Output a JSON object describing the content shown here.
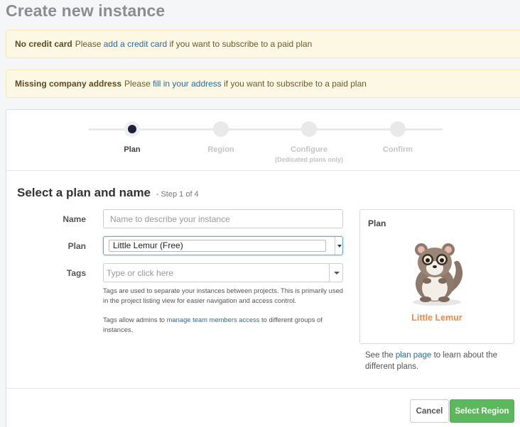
{
  "page": {
    "title": "Create new instance"
  },
  "alerts": [
    {
      "strong": "No credit card",
      "pre": "Please ",
      "link": "add a credit card",
      "post": " if you want to subscribe to a paid plan"
    },
    {
      "strong": "Missing company address",
      "pre": "Please ",
      "link": "fill in your address",
      "post": " if you want to subscribe to a paid plan"
    }
  ],
  "wizard": {
    "steps": [
      {
        "label": "Plan",
        "sub": ""
      },
      {
        "label": "Region",
        "sub": ""
      },
      {
        "label": "Configure",
        "sub": "(Dedicated plans only)"
      },
      {
        "label": "Confirm",
        "sub": ""
      }
    ],
    "active_index": 0
  },
  "section": {
    "title": "Select a plan and name",
    "step": "- Step 1 of 4"
  },
  "form": {
    "name_label": "Name",
    "name_placeholder": "Name to describe your instance",
    "plan_label": "Plan",
    "plan_value": "Little Lemur (Free)",
    "tags_label": "Tags",
    "tags_placeholder": "Type or click here",
    "help1": "Tags are used to separate your instances between projects. This is primarily used in the project listing view for easier navigation and access control.",
    "help2_pre": "Tags allow admins to ",
    "help2_link": "manage team members access",
    "help2_post": " to different groups of instances."
  },
  "plan_card": {
    "title": "Plan",
    "name": "Little Lemur",
    "name_color": "#ef8a47",
    "image_icon": "lemur-mascot"
  },
  "plan_note": {
    "pre": "See the ",
    "link": "plan page",
    "post": " to learn about the different plans."
  },
  "footer": {
    "cancel": "Cancel",
    "primary": "Select Region",
    "primary_color": "#5cb85c"
  }
}
